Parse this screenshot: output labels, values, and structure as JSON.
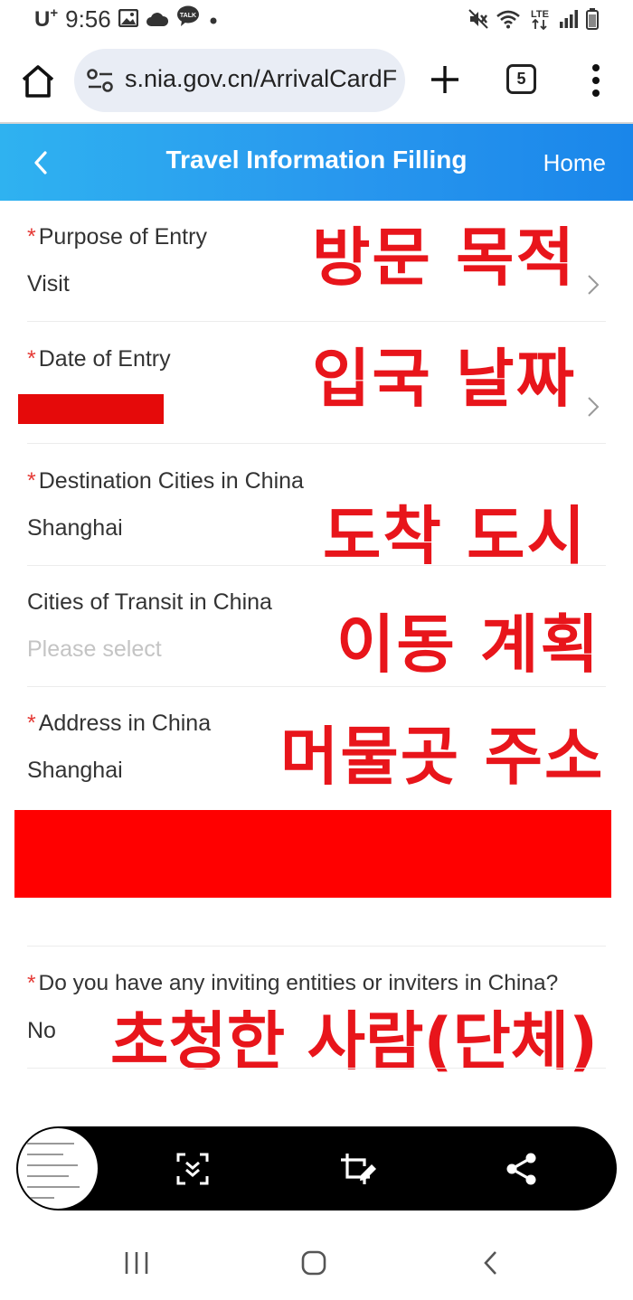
{
  "status_bar": {
    "carrier": "U",
    "carrier_sup": "+",
    "time": "9:56",
    "icons": [
      "gallery-icon",
      "cloud-icon",
      "talk-icon",
      "dot-icon",
      "mute-icon",
      "wifi-icon",
      "lte-icon",
      "signal-icon",
      "battery-icon"
    ],
    "lte_label": "LTE",
    "talk_label": "TALK"
  },
  "browser": {
    "url": "s.nia.gov.cn/ArrivalCardF",
    "tab_count": "5"
  },
  "header": {
    "title": "Travel Information Filling",
    "home": "Home"
  },
  "form": {
    "purpose": {
      "required": "*",
      "label": "Purpose of Entry",
      "value": "Visit",
      "annotation": "방문 목적"
    },
    "date": {
      "required": "*",
      "label": "Date of Entry",
      "annotation": "입국 날짜"
    },
    "destination": {
      "required": "*",
      "label": "Destination Cities in China",
      "value": "Shanghai",
      "annotation": "도착 도시"
    },
    "transit": {
      "label": "Cities of Transit in China",
      "placeholder": "Please select",
      "annotation": "이동 계획"
    },
    "address": {
      "required": "*",
      "label": "Address in China",
      "value": "Shanghai",
      "annotation": "머물곳 주소"
    },
    "inviting": {
      "required": "*",
      "label": "Do you have any inviting entities or inviters in China?",
      "value": "No",
      "annotation": "초청한 사람(단체)"
    }
  },
  "colors": {
    "header_gradient_start": "#2fb2f0",
    "header_gradient_end": "#1a86ea",
    "required": "#e53935",
    "annotation": "#e8151b",
    "redaction": "#ff0000"
  }
}
